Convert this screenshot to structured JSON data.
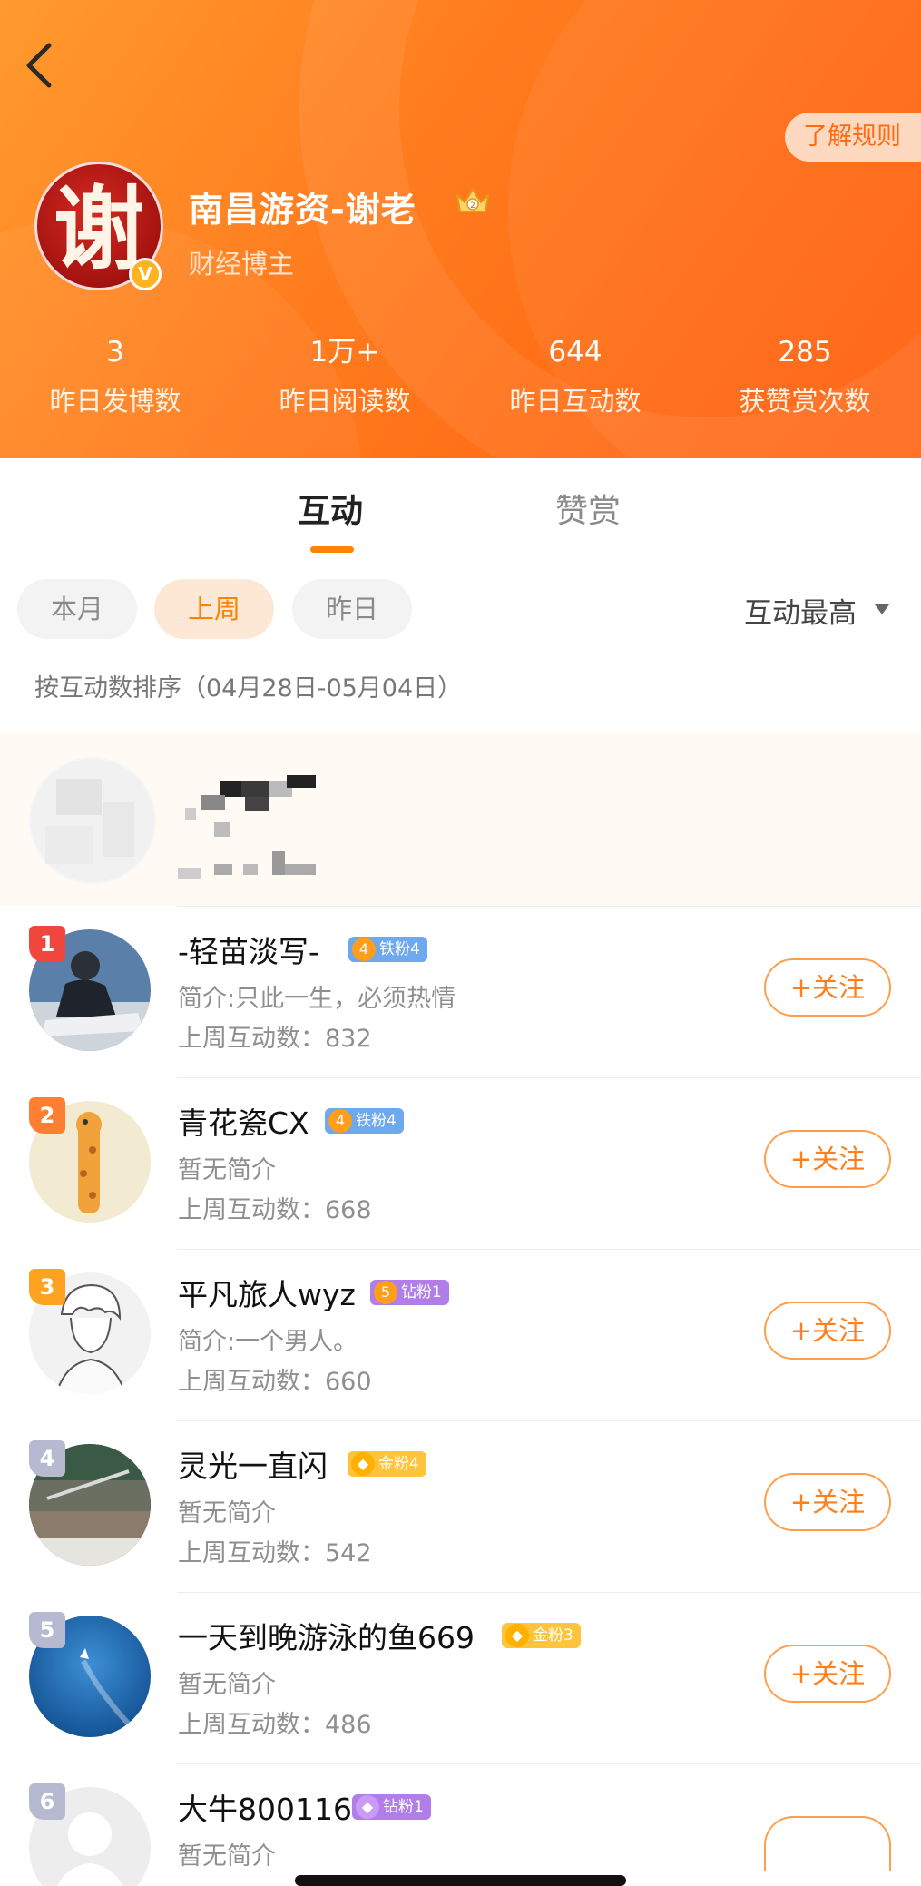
{
  "header": {
    "rules_label": "了解规则",
    "name": "南昌游资-谢老",
    "role": "财经博主",
    "avatar_glyph": "谢",
    "verified_mark": "V",
    "crown_icon": "crown-icon",
    "back_icon": "chevron-left-icon"
  },
  "stats": [
    {
      "value": "3",
      "label": "昨日发博数"
    },
    {
      "value": "1万+",
      "label": "昨日阅读数"
    },
    {
      "value": "644",
      "label": "昨日互动数"
    },
    {
      "value": "285",
      "label": "获赞赏次数"
    }
  ],
  "tabs": [
    {
      "label": "互动",
      "active": true
    },
    {
      "label": "赞赏",
      "active": false
    }
  ],
  "filters": [
    {
      "label": "本月",
      "active": false
    },
    {
      "label": "上周",
      "active": true
    },
    {
      "label": "昨日",
      "active": false
    }
  ],
  "sort": {
    "label": "互动最高"
  },
  "sort_note": "按互动数排序（04月28日-05月04日）",
  "rows": [
    {
      "rank": "1",
      "name": "-轻苗淡写-",
      "badge_level": "4",
      "badge": "铁粉4",
      "intro": "简介:只此一生，必须热情",
      "count": "上周互动数：832",
      "follow": "+关注"
    },
    {
      "rank": "2",
      "name": "青花瓷CX",
      "badge_level": "4",
      "badge": "铁粉4",
      "intro": "暂无简介",
      "count": "上周互动数：668",
      "follow": "+关注"
    },
    {
      "rank": "3",
      "name": "平凡旅人wyz",
      "badge_level": "5",
      "badge": "钻粉1",
      "intro": "简介:一个男人。",
      "count": "上周互动数：660",
      "follow": "+关注"
    },
    {
      "rank": "4",
      "name": "灵光一直闪",
      "badge": "金粉4",
      "intro": "暂无简介",
      "count": "上周互动数：542",
      "follow": "+关注"
    },
    {
      "rank": "5",
      "name": "一天到晚游泳的鱼669",
      "badge": "金粉3",
      "intro": "暂无简介",
      "count": "上周互动数：486",
      "follow": "+关注"
    },
    {
      "rank": "6",
      "name": "大牛800116",
      "badge": "钻粉1",
      "intro": "暂无简介",
      "count": "",
      "follow": ""
    }
  ],
  "colors": {
    "accent": "#ff8200",
    "rank_1": "#f0463e",
    "rank_2": "#ff7f32",
    "rank_3": "#ffa21f",
    "rank_other": "#b6b9cf",
    "badge_iron": "#6ea8ee",
    "badge_diamond": "#b07de9",
    "badge_gold": "#ffc43c"
  }
}
